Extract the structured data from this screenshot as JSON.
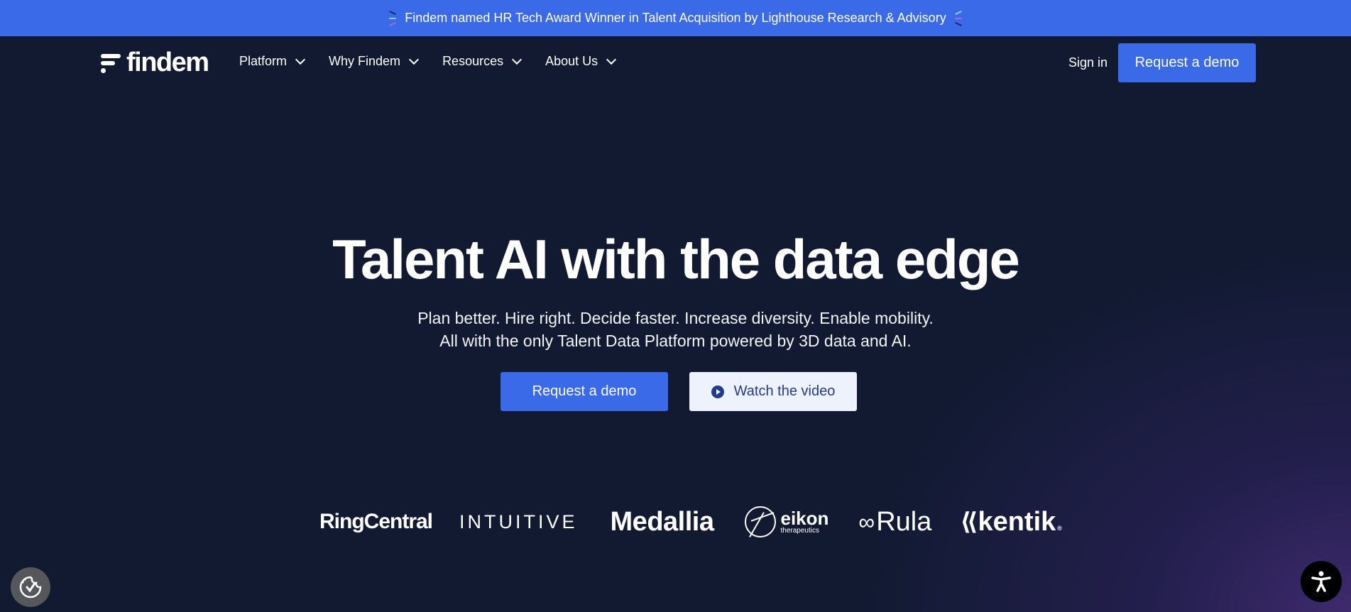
{
  "announcement": {
    "text": "Findem named HR Tech Award Winner in Talent Acquisition by Lighthouse Research & Advisory"
  },
  "nav": {
    "logo_text": "findem",
    "items": [
      {
        "label": "Platform"
      },
      {
        "label": "Why Findem"
      },
      {
        "label": "Resources"
      },
      {
        "label": "About Us"
      }
    ],
    "sign_in": "Sign in",
    "cta": "Request a demo"
  },
  "hero": {
    "title": "Talent AI with the data edge",
    "subtitle_line1": "Plan better. Hire right. Decide faster. Increase diversity. Enable mobility.",
    "subtitle_line2": "All with the only Talent Data Platform powered by 3D data and AI.",
    "primary_cta": "Request a demo",
    "secondary_cta": "Watch the video"
  },
  "customer_logos": {
    "ringcentral": "RingCentral",
    "intuitive": "INTUITIVE",
    "medallia": "Medallia",
    "eikon_main": "eikon",
    "eikon_sub": "therapeutics",
    "rula": "Rula",
    "kentik": "kentik"
  },
  "colors": {
    "accent": "#3b6ae8",
    "background": "#111a31",
    "secondary_button_bg": "#eef2fc",
    "secondary_button_text": "#243a8c"
  }
}
